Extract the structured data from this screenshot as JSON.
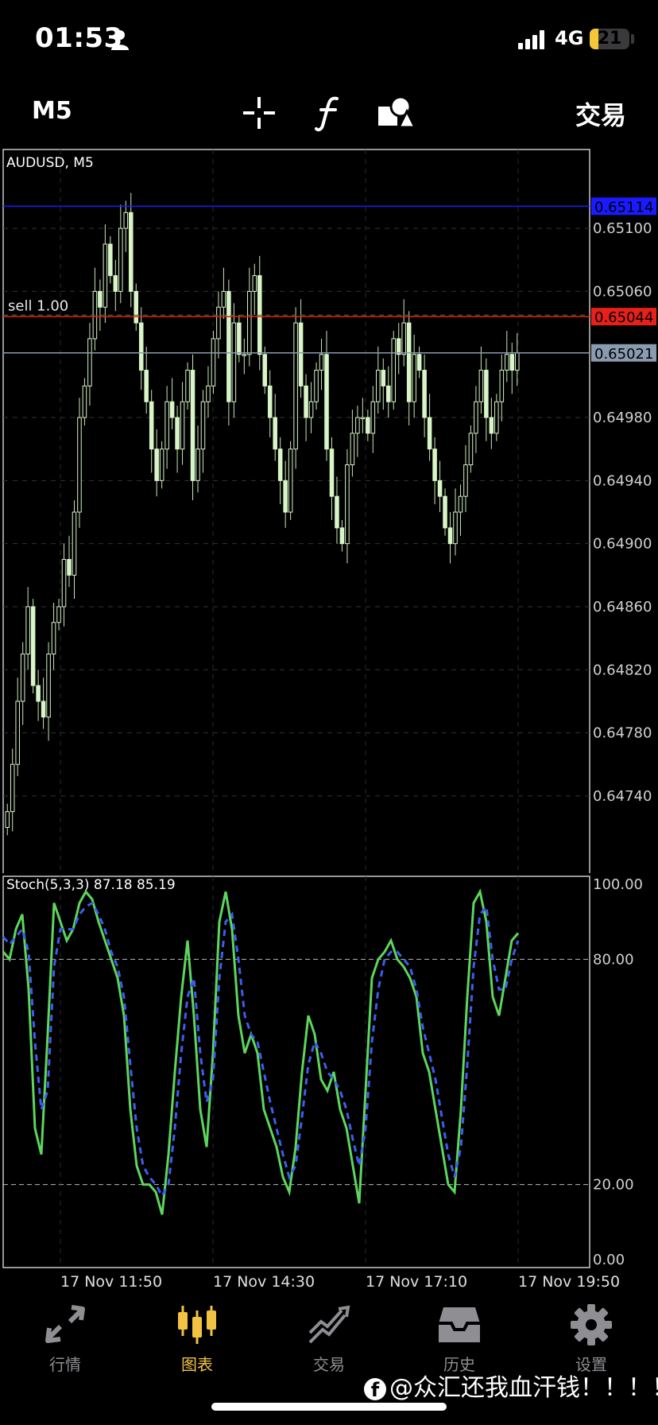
{
  "status": {
    "time": "01:53",
    "network": "4G",
    "battery": "21",
    "battery_level": 0.21
  },
  "toolbar": {
    "timeframe": "M5",
    "crosshair_icon": "crosshair-icon",
    "indicator_icon": "function-icon",
    "objects_icon": "shapes-icon",
    "trade_label": "交易"
  },
  "chart_data": [
    {
      "type": "candlestick",
      "title": "AUDUSD, M5",
      "ylim": [
        0.6469,
        0.6515
      ],
      "y_ticks": [
        "0.65100",
        "0.65060",
        "0.64980",
        "0.64940",
        "0.64900",
        "0.64860",
        "0.64820",
        "0.64780",
        "0.64740"
      ],
      "grid": true,
      "price_lines": [
        {
          "label": "0.65114",
          "value": 0.65114,
          "color": "#1a1aff"
        },
        {
          "label": "0.65044",
          "value": 0.65044,
          "color": "#e8201c"
        },
        {
          "label": "0.65021",
          "value": 0.65021,
          "color": "#8a9bb0"
        }
      ],
      "order_line": {
        "label": "sell 1.00",
        "value": 0.6505
      },
      "closes": [
        0.6473,
        0.6476,
        0.648,
        0.6483,
        0.6486,
        0.6481,
        0.648,
        0.6479,
        0.6483,
        0.6485,
        0.6486,
        0.6489,
        0.6488,
        0.6492,
        0.6498,
        0.65,
        0.6503,
        0.6506,
        0.6505,
        0.6509,
        0.6507,
        0.6506,
        0.651,
        0.6511,
        0.6506,
        0.6504,
        0.6501,
        0.6499,
        0.6496,
        0.6494,
        0.6496,
        0.6499,
        0.6498,
        0.6496,
        0.6499,
        0.6501,
        0.6494,
        0.6496,
        0.6499,
        0.65,
        0.6503,
        0.6505,
        0.6506,
        0.6499,
        0.6504,
        0.6502,
        0.6502,
        0.6506,
        0.6507,
        0.6502,
        0.65,
        0.6498,
        0.6496,
        0.6494,
        0.6492,
        0.6496,
        0.6504,
        0.65,
        0.6498,
        0.6499,
        0.6501,
        0.6502,
        0.6496,
        0.6493,
        0.6491,
        0.649,
        0.6495,
        0.6497,
        0.6498,
        0.6498,
        0.6497,
        0.6499,
        0.6501,
        0.65,
        0.6499,
        0.6503,
        0.6502,
        0.6504,
        0.6499,
        0.6502,
        0.6501,
        0.6498,
        0.6496,
        0.6494,
        0.6493,
        0.6491,
        0.649,
        0.6492,
        0.6493,
        0.6495,
        0.6497,
        0.6499,
        0.6501,
        0.6498,
        0.6497,
        0.6499,
        0.6501,
        0.6502,
        0.6501,
        0.65021
      ],
      "x_ticks": [
        "17 Nov 11:50",
        "17 Nov 14:30",
        "17 Nov 17:10",
        "17 Nov 19:50"
      ]
    },
    {
      "type": "line",
      "title": "Stoch(5,3,3) 87.18 85.19",
      "ylim": [
        0,
        100
      ],
      "y_ticks": [
        "100.00",
        "80.00",
        "20.00",
        "0.00"
      ],
      "levels": [
        80,
        20
      ],
      "series": [
        {
          "color": "#5cd65c",
          "dash": false,
          "values": [
            82,
            80,
            88,
            92,
            72,
            35,
            28,
            60,
            95,
            90,
            85,
            88,
            95,
            98,
            96,
            90,
            85,
            80,
            75,
            65,
            40,
            25,
            20,
            20,
            18,
            12,
            28,
            50,
            70,
            85,
            65,
            40,
            30,
            55,
            90,
            98,
            88,
            65,
            55,
            60,
            55,
            40,
            35,
            30,
            22,
            18,
            30,
            50,
            65,
            60,
            48,
            45,
            50,
            40,
            35,
            25,
            15,
            45,
            75,
            80,
            82,
            85,
            80,
            78,
            75,
            70,
            55,
            50,
            40,
            30,
            20,
            18,
            40,
            70,
            95,
            98,
            90,
            70,
            65,
            75,
            85,
            87
          ]
        },
        {
          "color": "#3d5cf0",
          "dash": true,
          "values": [
            86,
            84,
            86,
            88,
            82,
            58,
            40,
            45,
            78,
            88,
            88,
            88,
            92,
            94,
            95,
            92,
            88,
            82,
            78,
            70,
            52,
            35,
            25,
            22,
            20,
            17,
            20,
            35,
            55,
            70,
            75,
            55,
            42,
            48,
            75,
            90,
            92,
            80,
            65,
            60,
            58,
            50,
            42,
            35,
            28,
            22,
            25,
            38,
            52,
            58,
            55,
            50,
            48,
            45,
            40,
            32,
            25,
            35,
            58,
            72,
            80,
            82,
            82,
            80,
            78,
            72,
            62,
            55,
            48,
            38,
            28,
            22,
            30,
            52,
            78,
            92,
            94,
            80,
            72,
            72,
            80,
            85
          ]
        }
      ],
      "x_ticks": [
        "17 Nov 11:50",
        "17 Nov 14:30",
        "17 Nov 17:10",
        "17 Nov 19:50"
      ]
    }
  ],
  "tabbar": {
    "items": [
      {
        "label": "行情",
        "icon": "quotes-icon"
      },
      {
        "label": "图表",
        "icon": "chart-candles-icon"
      },
      {
        "label": "交易",
        "icon": "trade-icon"
      },
      {
        "label": "历史",
        "icon": "history-icon"
      },
      {
        "label": "设置",
        "icon": "gear-icon"
      }
    ],
    "active_color": "#f2c244",
    "inactive_color": "#8e8e93"
  },
  "watermark": {
    "text": "@众汇还我血汗钱！！！！"
  }
}
